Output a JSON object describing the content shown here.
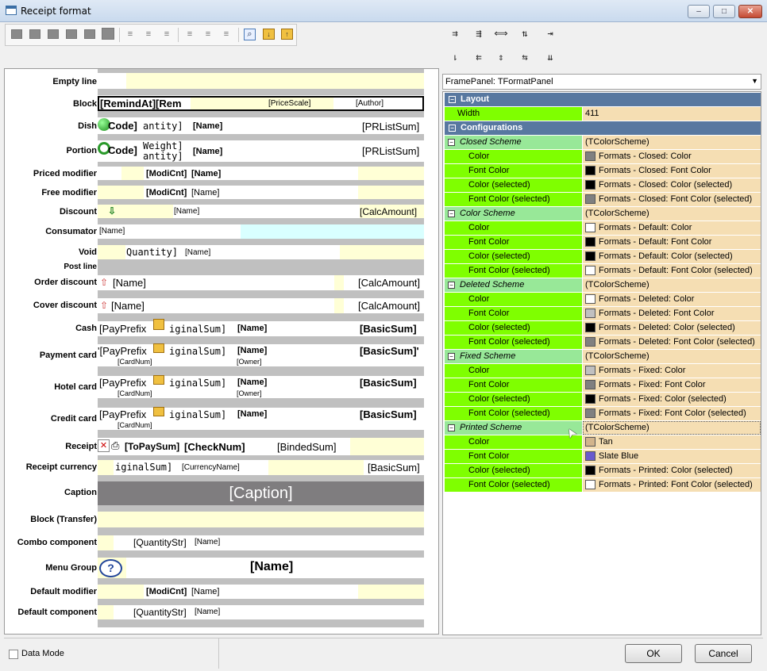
{
  "window": {
    "title": "Receipt format",
    "minimize": "–",
    "restore": "□",
    "close": "✕"
  },
  "right_toolbar": {
    "row1": [
      "⇉",
      "⇶",
      "⟺",
      "⇅",
      "⇥"
    ],
    "row2": [
      "⇂",
      "⇇",
      "⇕",
      "⇆",
      "⇊"
    ]
  },
  "canvas": {
    "rows": {
      "empty_line": "Empty line",
      "block": "Block",
      "dish": "Dish",
      "portion": "Portion",
      "priced_modifier": "Priced modifier",
      "free_modifier": "Free modifier",
      "discount": "Discount",
      "consumator": "Consumator",
      "void": "Void",
      "post_line": "Post line",
      "order_discount": "Order discount",
      "cover_discount": "Cover discount",
      "cash": "Cash",
      "payment_card": "Payment card",
      "hotel_card": "Hotel card",
      "credit_card": "Credit card",
      "receipt": "Receipt",
      "receipt_currency": "Receipt currency",
      "caption": "Caption",
      "block_transfer": "Block (Transfer)",
      "combo_component": "Combo component",
      "menu_group": "Menu Group",
      "default_modifier": "Default modifier",
      "default_component": "Default component"
    },
    "fields": {
      "remindat": "[RemindAt][Rem",
      "pricescale": "[PriceScale]",
      "author": "[Author]",
      "code": "Code]",
      "antity": "antity]",
      "name": "[Name]",
      "prlistsum": "[PRListSum]",
      "weight": "Weight]",
      "modicnt": "[ModiCnt]",
      "calcamount": "[CalcAmount]",
      "quantity": "Quantity]",
      "payprefix": "[PayPrefix",
      "payprefix2": "'[PayPrefix",
      "iginalsum": "iginalSum]",
      "basicsum": "[BasicSum]",
      "basicsum2": "[BasicSum]'",
      "cardnum": "[CardNum]",
      "owner": "[Owner]",
      "topaysum": "[ToPaySum]",
      "checknum": "[CheckNum]",
      "bindedsum": "[BindedSum]",
      "currencyname": "[CurrencyName]",
      "caption": "[Caption]",
      "quantitystr": "[QuantityStr]"
    }
  },
  "frame_panel": {
    "label": "FramePanel: TFormatPanel"
  },
  "properties": {
    "layout": {
      "header": "Layout",
      "width_label": "Width",
      "width_value": "411"
    },
    "configurations": {
      "header": "Configurations"
    },
    "type_name": "(TColorScheme)",
    "prop_names": {
      "color": "Color",
      "font_color": "Font Color",
      "color_sel": "Color (selected)",
      "font_color_sel": "Font Color (selected)"
    },
    "schemes": [
      {
        "name": "Closed Scheme",
        "values": [
          "Formats - Closed: Color",
          "Formats - Closed: Font Color",
          "Formats - Closed: Color (selected)",
          "Formats - Closed: Font Color (selected)"
        ],
        "swatches": [
          "#808080",
          "#000000",
          "#000000",
          "#808080"
        ]
      },
      {
        "name": "Color Scheme",
        "values": [
          "Formats - Default: Color",
          "Formats - Default: Font Color",
          "Formats - Default: Color (selected)",
          "Formats - Default: Font Color (selected)"
        ],
        "swatches": [
          "#ffffff",
          "#000000",
          "#000000",
          "#ffffff"
        ]
      },
      {
        "name": "Deleted Scheme",
        "values": [
          "Formats - Deleted: Color",
          "Formats - Deleted: Font Color",
          "Formats - Deleted: Color (selected)",
          "Formats - Deleted: Font Color (selected)"
        ],
        "swatches": [
          "#ffffff",
          "#c0c0c0",
          "#000000",
          "#808080"
        ]
      },
      {
        "name": "Fixed Scheme",
        "values": [
          "Formats - Fixed: Color",
          "Formats - Fixed: Font Color",
          "Formats - Fixed: Color (selected)",
          "Formats - Fixed: Font Color (selected)"
        ],
        "swatches": [
          "#c0c0c0",
          "#808080",
          "#000000",
          "#808080"
        ]
      },
      {
        "name": "Printed Scheme",
        "values": [
          "Tan",
          "Slate Blue",
          "Formats - Printed: Color (selected)",
          "Formats - Printed: Font Color (selected)"
        ],
        "swatches": [
          "#d2b48c",
          "#6a5acd",
          "#000000",
          "#ffffff"
        ]
      }
    ]
  },
  "footer": {
    "data_mode": "Data Mode",
    "ok": "OK",
    "cancel": "Cancel"
  },
  "colors": {
    "prop_name_bg": "#7fff00",
    "prop_value_bg": "#f5deb3",
    "category_bg": "#5878a0",
    "band_yellow": "#ffffd6",
    "caption_bg": "#7f7d7f"
  }
}
